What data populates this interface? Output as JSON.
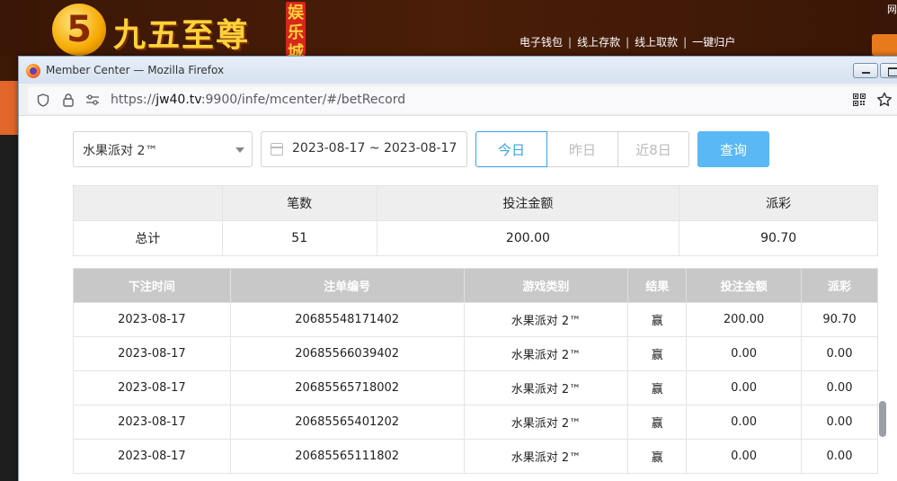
{
  "site": {
    "logo_number": "5",
    "logo_text": "九五至尊",
    "logo_tag": [
      "娱",
      "乐",
      "城"
    ],
    "nav": [
      "电子钱包",
      "线上存款",
      "线上取款",
      "一键归户"
    ],
    "corner_text": "网"
  },
  "window": {
    "title": "Member Center — Mozilla Firefox",
    "url_prefix": "https://",
    "url_host": "jw40.tv",
    "url_rest": ":9900/infe/mcenter/#/betRecord"
  },
  "filters": {
    "game": "水果派对 2™",
    "date_range": "2023-08-17 ~ 2023-08-17",
    "quick_ranges": [
      "今日",
      "昨日",
      "近8日"
    ],
    "selected_range": "今日",
    "query_label": "查询"
  },
  "summary": {
    "headers": [
      "",
      "笔数",
      "投注金额",
      "派彩"
    ],
    "row": [
      "总计",
      "51",
      "200.00",
      "90.70"
    ]
  },
  "records": {
    "headers": [
      "下注时间",
      "注单编号",
      "游戏类别",
      "结果",
      "投注金额",
      "派彩"
    ],
    "rows": [
      [
        "2023-08-17",
        "20685548171402",
        "水果派对 2™",
        "赢",
        "200.00",
        "90.70"
      ],
      [
        "2023-08-17",
        "20685566039402",
        "水果派对 2™",
        "赢",
        "0.00",
        "0.00"
      ],
      [
        "2023-08-17",
        "20685565718002",
        "水果派对 2™",
        "赢",
        "0.00",
        "0.00"
      ],
      [
        "2023-08-17",
        "20685565401202",
        "水果派对 2™",
        "赢",
        "0.00",
        "0.00"
      ],
      [
        "2023-08-17",
        "20685565111802",
        "水果派对 2™",
        "赢",
        "0.00",
        "0.00"
      ]
    ]
  },
  "colors": {
    "accent": "#3aa0e8",
    "query_button": "#5ab8f4",
    "header_gray": "#c8c8c8"
  }
}
